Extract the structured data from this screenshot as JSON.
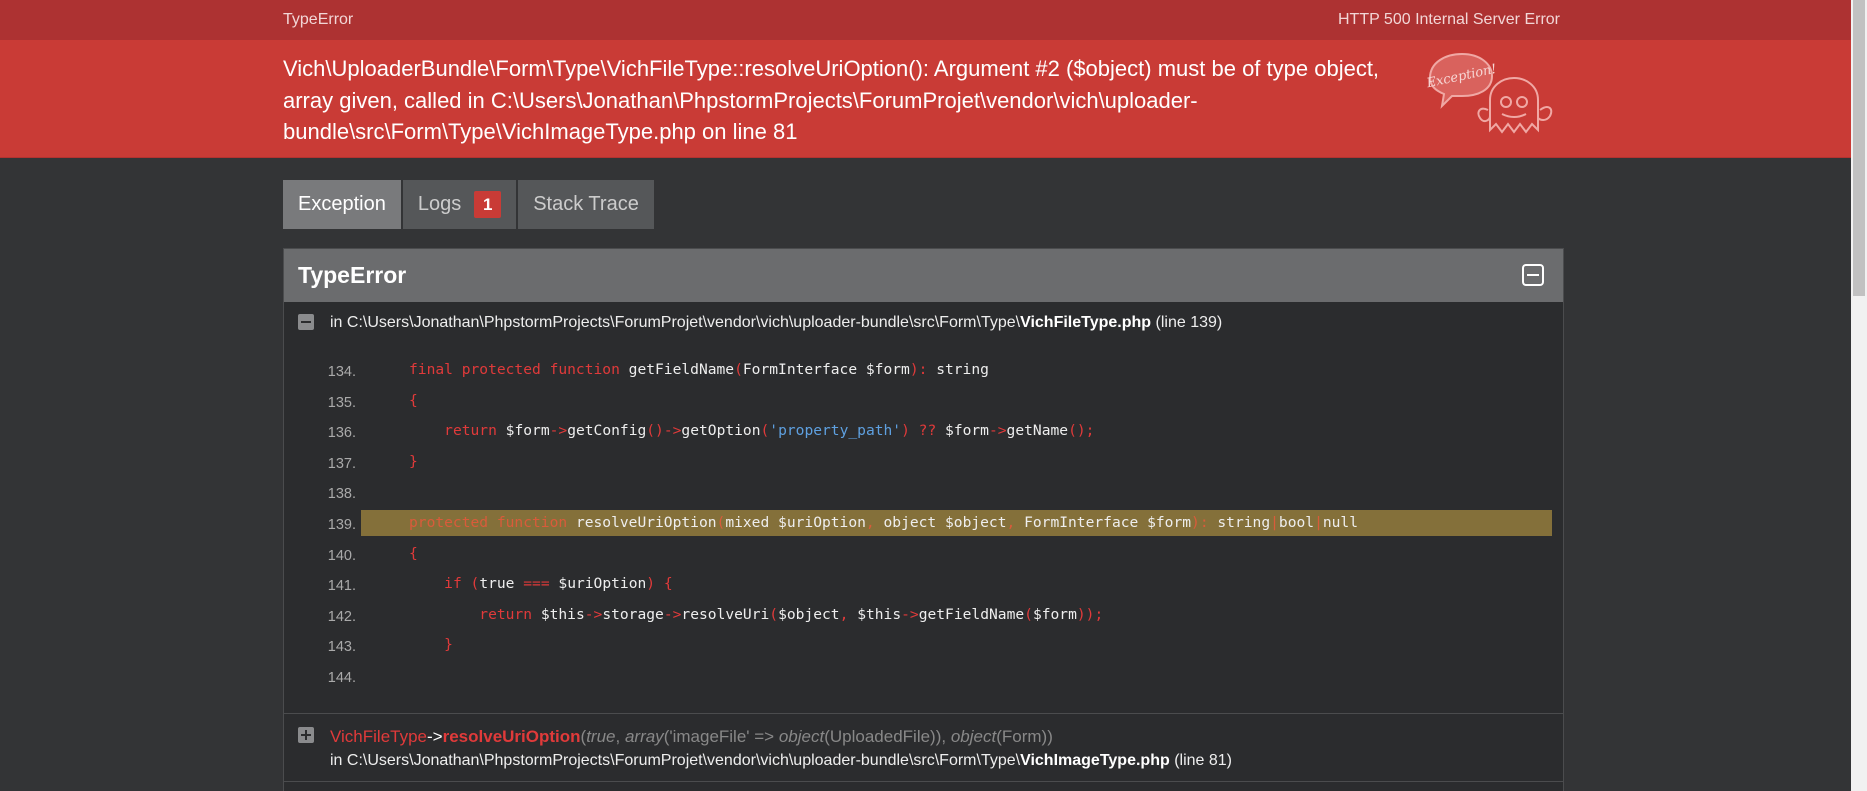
{
  "topbar": {
    "left": "TypeError",
    "right": "HTTP 500 Internal Server Error"
  },
  "header": {
    "message": "Vich\\UploaderBundle\\Form\\Type\\VichFileType::resolveUriOption(): Argument #2 ($object) must be of type object, array given, called in C:\\Users\\Jonathan\\PhpstormProjects\\ForumProjet\\vendor\\vich\\uploader-bundle\\src\\Form\\Type\\VichImageType.php on line 81",
    "ghost_text": "Exception!"
  },
  "tabs": [
    {
      "label": "Exception",
      "active": true
    },
    {
      "label": "Logs",
      "badge": "1"
    },
    {
      "label": "Stack Trace"
    }
  ],
  "panel": {
    "title": "TypeError",
    "file_prefix": "in C:\\Users\\Jonathan\\PhpstormProjects\\ForumProjet\\vendor\\vich\\uploader-bundle\\src\\Form\\Type\\",
    "file_name": "VichFileType.php",
    "file_suffix": " (line 139)"
  },
  "code_lines": {
    "n134": "134.",
    "n135": "135.",
    "n136": "136.",
    "n137": "137.",
    "n138": "138.",
    "n139": "139.",
    "n140": "140.",
    "n141": "141.",
    "n142": "142.",
    "n143": "143.",
    "n144": "144."
  },
  "trace": {
    "class": "VichFileType",
    "arrow": "->",
    "function": "resolveUriOption",
    "args_open": "(",
    "arg1": "true",
    "sep1": ", ",
    "arg2_fn": "array",
    "arg2_body": "('imageFile' => ",
    "arg2_obj": "object",
    "arg2_obj_body": "(UploadedFile))",
    "sep2": ", ",
    "arg3_obj": "object",
    "arg3_body": "(Form))",
    "file_prefix": "in C:\\Users\\Jonathan\\PhpstormProjects\\ForumProjet\\vendor\\vich\\uploader-bundle\\src\\Form\\Type\\",
    "file_name": "VichImageType.php",
    "file_suffix": " (line 81)"
  },
  "colors": {
    "topbar": "#ad3232",
    "header": "#c93b36",
    "background": "#333436",
    "highlight_line": "#84703a",
    "keyword": "#e03a3a",
    "string": "#5ea0e0"
  }
}
